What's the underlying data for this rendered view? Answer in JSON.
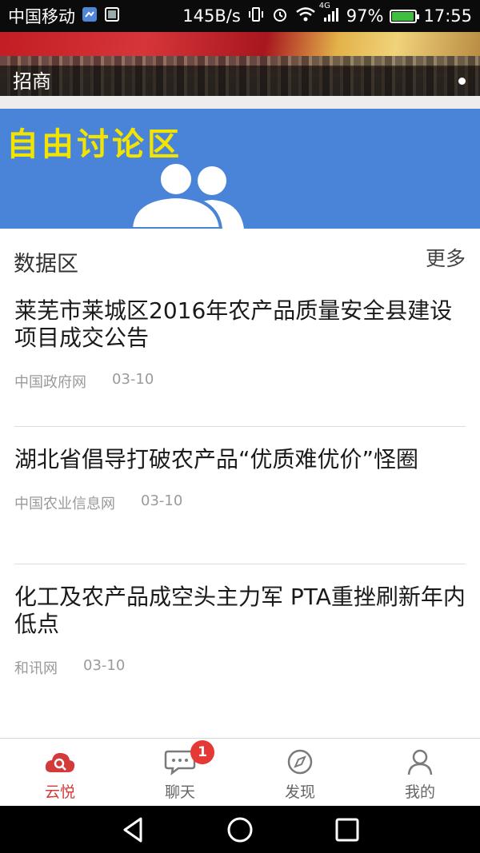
{
  "status_bar": {
    "carrier": "中国移动",
    "speed": "145B/s",
    "network": "4G",
    "battery_percent": "97%",
    "battery_level": 0.97,
    "time": "17:55",
    "icons": [
      "notification-icon",
      "image-icon",
      "vibrate-icon",
      "alarm-icon",
      "wifi-icon",
      "signal-icon",
      "battery-icon"
    ]
  },
  "banner": {
    "title": "招商"
  },
  "forum": {
    "title": "自由讨论区"
  },
  "section": {
    "title": "数据区",
    "more": "更多"
  },
  "news": [
    {
      "title": "莱芜市莱城区2016年农产品质量安全县建设项目成交公告",
      "source": "中国政府网",
      "date": "03-10"
    },
    {
      "title": "湖北省倡导打破农产品“优质难优价”怪圈",
      "source": "中国农业信息网",
      "date": "03-10"
    },
    {
      "title": "化工及农产品成空头主力军 PTA重挫刷新年内低点",
      "source": "和讯网",
      "date": "03-10"
    }
  ],
  "tabs": [
    {
      "label": "云悦",
      "icon": "cloud-search-icon",
      "active": true
    },
    {
      "label": "聊天",
      "icon": "chat-icon",
      "badge": "1"
    },
    {
      "label": "发现",
      "icon": "compass-icon"
    },
    {
      "label": "我的",
      "icon": "person-icon"
    }
  ],
  "colors": {
    "accent": "#d33a3a",
    "forum_bg": "#4a84d8",
    "forum_title": "#f3e400",
    "badge": "#e53935"
  }
}
